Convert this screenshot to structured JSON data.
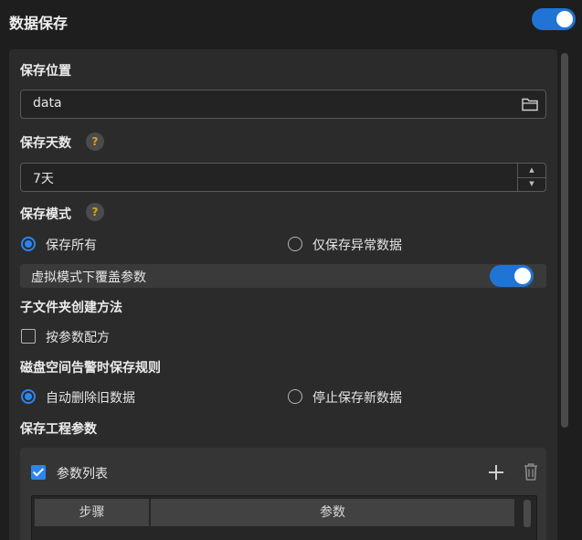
{
  "header": {
    "title": "数据保存",
    "enabled": true
  },
  "save_location": {
    "label": "保存位置",
    "value": "data",
    "icon": "folder-icon"
  },
  "save_days": {
    "label": "保存天数",
    "help": "?",
    "value": "7天",
    "up": "▲",
    "down": "▼"
  },
  "save_mode": {
    "label": "保存模式",
    "help": "?",
    "options": [
      {
        "label": "保存所有",
        "selected": true
      },
      {
        "label": "仅保存异常数据",
        "selected": false
      }
    ],
    "override": {
      "label": "虚拟模式下覆盖参数",
      "enabled": true
    }
  },
  "subfolder": {
    "label": "子文件夹创建方法",
    "checkbox": {
      "label": "按参数配方",
      "checked": false
    }
  },
  "disk_rule": {
    "label": "磁盘空间告警时保存规则",
    "options": [
      {
        "label": "自动删除旧数据",
        "selected": true
      },
      {
        "label": "停止保存新数据",
        "selected": false
      }
    ]
  },
  "project_params": {
    "label": "保存工程参数",
    "list": {
      "label": "参数列表",
      "checked": true,
      "add_icon": "plus-icon",
      "delete_icon": "trash-icon"
    },
    "table": {
      "columns": [
        "步骤",
        "参数"
      ]
    }
  },
  "colors": {
    "accent": "#2a86ee",
    "toggle": "#1f74d6",
    "panel": "#2b2b2c",
    "help_mark": "#d9a520"
  }
}
